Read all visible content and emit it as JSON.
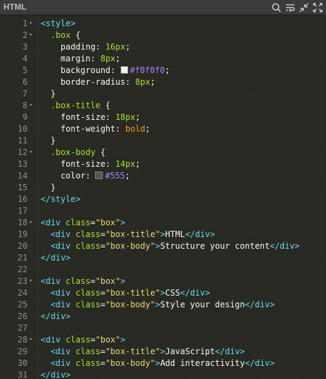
{
  "panel": {
    "title": "HTML",
    "tools": [
      "search-icon",
      "wrap-lines-icon",
      "collapse-icon",
      "expand-icon"
    ]
  },
  "colors": {
    "box_bg": "#f0f0f0",
    "body_text": "#555"
  },
  "lines": [
    {
      "n": "1",
      "fold": "▾",
      "tokens": [
        [
          "tag",
          "<style>"
        ]
      ]
    },
    {
      "n": "2",
      "fold": "▾",
      "tokens": [
        [
          "t",
          "  "
        ],
        [
          "sel",
          ".box"
        ],
        [
          "t",
          " {"
        ]
      ]
    },
    {
      "n": "3",
      "fold": "",
      "tokens": [
        [
          "t",
          "    "
        ],
        [
          "prop",
          "padding"
        ],
        [
          "t",
          ": "
        ],
        [
          "num",
          "16px"
        ],
        [
          "t",
          ";"
        ]
      ]
    },
    {
      "n": "4",
      "fold": "",
      "tokens": [
        [
          "t",
          "    "
        ],
        [
          "prop",
          "margin"
        ],
        [
          "t",
          ": "
        ],
        [
          "num",
          "8px"
        ],
        [
          "t",
          ";"
        ]
      ]
    },
    {
      "n": "5",
      "fold": "",
      "tokens": [
        [
          "t",
          "    "
        ],
        [
          "prop",
          "background"
        ],
        [
          "t",
          ": "
        ],
        [
          "swatch",
          "#f0f0f0"
        ],
        [
          "hex",
          "#f0f0f0"
        ],
        [
          "t",
          ";"
        ]
      ]
    },
    {
      "n": "6",
      "fold": "",
      "tokens": [
        [
          "t",
          "    "
        ],
        [
          "prop",
          "border-radius"
        ],
        [
          "t",
          ": "
        ],
        [
          "num",
          "8px"
        ],
        [
          "t",
          ";"
        ]
      ]
    },
    {
      "n": "7",
      "fold": "",
      "tokens": [
        [
          "t",
          "  }"
        ]
      ]
    },
    {
      "n": "8",
      "fold": "▾",
      "tokens": [
        [
          "t",
          "  "
        ],
        [
          "sel",
          ".box-title"
        ],
        [
          "t",
          " {"
        ]
      ]
    },
    {
      "n": "9",
      "fold": "",
      "tokens": [
        [
          "t",
          "    "
        ],
        [
          "prop",
          "font-size"
        ],
        [
          "t",
          ": "
        ],
        [
          "num",
          "18px"
        ],
        [
          "t",
          ";"
        ]
      ]
    },
    {
      "n": "10",
      "fold": "",
      "tokens": [
        [
          "t",
          "    "
        ],
        [
          "prop",
          "font-weight"
        ],
        [
          "t",
          ": "
        ],
        [
          "kw",
          "bold"
        ],
        [
          "t",
          ";"
        ]
      ]
    },
    {
      "n": "11",
      "fold": "",
      "tokens": [
        [
          "t",
          "  }"
        ]
      ]
    },
    {
      "n": "12",
      "fold": "▾",
      "tokens": [
        [
          "t",
          "  "
        ],
        [
          "sel",
          ".box-body"
        ],
        [
          "t",
          " {"
        ]
      ]
    },
    {
      "n": "13",
      "fold": "",
      "tokens": [
        [
          "t",
          "    "
        ],
        [
          "prop",
          "font-size"
        ],
        [
          "t",
          ": "
        ],
        [
          "num",
          "14px"
        ],
        [
          "t",
          ";"
        ]
      ]
    },
    {
      "n": "14",
      "fold": "",
      "tokens": [
        [
          "t",
          "    "
        ],
        [
          "prop",
          "color"
        ],
        [
          "t",
          ": "
        ],
        [
          "swatch",
          "#555555"
        ],
        [
          "hex",
          "#555"
        ],
        [
          "t",
          ";"
        ]
      ]
    },
    {
      "n": "15",
      "fold": "",
      "tokens": [
        [
          "t",
          "  }"
        ]
      ]
    },
    {
      "n": "16",
      "fold": "",
      "tokens": [
        [
          "tag",
          "</style>"
        ]
      ]
    },
    {
      "n": "17",
      "fold": "",
      "tokens": []
    },
    {
      "n": "18",
      "fold": "▾",
      "tokens": [
        [
          "tag",
          "<div"
        ],
        [
          "t",
          " "
        ],
        [
          "attr",
          "class"
        ],
        [
          "t",
          "="
        ],
        [
          "str",
          "\"box\""
        ],
        [
          "tag",
          ">"
        ]
      ]
    },
    {
      "n": "19",
      "fold": "",
      "tokens": [
        [
          "t",
          "  "
        ],
        [
          "tag",
          "<div"
        ],
        [
          "t",
          " "
        ],
        [
          "attr",
          "class"
        ],
        [
          "t",
          "="
        ],
        [
          "str",
          "\"box-title\""
        ],
        [
          "tag",
          ">"
        ],
        [
          "t",
          "HTML"
        ],
        [
          "tag",
          "</div>"
        ]
      ]
    },
    {
      "n": "20",
      "fold": "",
      "tokens": [
        [
          "t",
          "  "
        ],
        [
          "tag",
          "<div"
        ],
        [
          "t",
          " "
        ],
        [
          "attr",
          "class"
        ],
        [
          "t",
          "="
        ],
        [
          "str",
          "\"box-body\""
        ],
        [
          "tag",
          ">"
        ],
        [
          "t",
          "Structure your content"
        ],
        [
          "tag",
          "</div>"
        ]
      ]
    },
    {
      "n": "21",
      "fold": "",
      "tokens": [
        [
          "tag",
          "</div>"
        ]
      ]
    },
    {
      "n": "22",
      "fold": "",
      "tokens": []
    },
    {
      "n": "23",
      "fold": "▾",
      "tokens": [
        [
          "tag",
          "<div"
        ],
        [
          "t",
          " "
        ],
        [
          "attr",
          "class"
        ],
        [
          "t",
          "="
        ],
        [
          "str",
          "\"box\""
        ],
        [
          "tag",
          ">"
        ]
      ]
    },
    {
      "n": "24",
      "fold": "",
      "tokens": [
        [
          "t",
          "  "
        ],
        [
          "tag",
          "<div"
        ],
        [
          "t",
          " "
        ],
        [
          "attr",
          "class"
        ],
        [
          "t",
          "="
        ],
        [
          "str",
          "\"box-title\""
        ],
        [
          "tag",
          ">"
        ],
        [
          "t",
          "CSS"
        ],
        [
          "tag",
          "</div>"
        ]
      ]
    },
    {
      "n": "25",
      "fold": "",
      "tokens": [
        [
          "t",
          "  "
        ],
        [
          "tag",
          "<div"
        ],
        [
          "t",
          " "
        ],
        [
          "attr",
          "class"
        ],
        [
          "t",
          "="
        ],
        [
          "str",
          "\"box-body\""
        ],
        [
          "tag",
          ">"
        ],
        [
          "t",
          "Style your design"
        ],
        [
          "tag",
          "</div>"
        ]
      ]
    },
    {
      "n": "26",
      "fold": "",
      "tokens": [
        [
          "tag",
          "</div>"
        ]
      ]
    },
    {
      "n": "27",
      "fold": "",
      "tokens": []
    },
    {
      "n": "28",
      "fold": "▾",
      "tokens": [
        [
          "tag",
          "<div"
        ],
        [
          "t",
          " "
        ],
        [
          "attr",
          "class"
        ],
        [
          "t",
          "="
        ],
        [
          "str",
          "\"box\""
        ],
        [
          "tag",
          ">"
        ]
      ]
    },
    {
      "n": "29",
      "fold": "",
      "tokens": [
        [
          "t",
          "  "
        ],
        [
          "tag",
          "<div"
        ],
        [
          "t",
          " "
        ],
        [
          "attr",
          "class"
        ],
        [
          "t",
          "="
        ],
        [
          "str",
          "\"box-title\""
        ],
        [
          "tag",
          ">"
        ],
        [
          "t",
          "JavaScript"
        ],
        [
          "tag",
          "</div>"
        ]
      ]
    },
    {
      "n": "30",
      "fold": "",
      "tokens": [
        [
          "t",
          "  "
        ],
        [
          "tag",
          "<div"
        ],
        [
          "t",
          " "
        ],
        [
          "attr",
          "class"
        ],
        [
          "t",
          "="
        ],
        [
          "str",
          "\"box-body\""
        ],
        [
          "tag",
          ">"
        ],
        [
          "t",
          "Add interactivity"
        ],
        [
          "tag",
          "</div>"
        ]
      ]
    },
    {
      "n": "31",
      "fold": "",
      "tokens": [
        [
          "tag",
          "</div>"
        ]
      ]
    }
  ]
}
